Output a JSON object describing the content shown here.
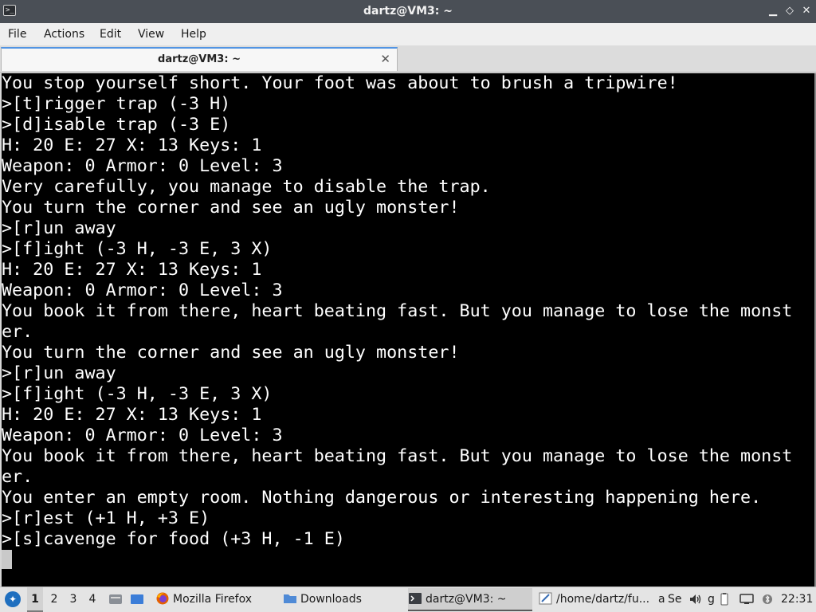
{
  "window": {
    "title": "dartz@VM3: ~",
    "minimize_glyph": "▁",
    "maximize_glyph": "◇",
    "close_glyph": "✕"
  },
  "menu": {
    "items": [
      "File",
      "Actions",
      "Edit",
      "View",
      "Help"
    ]
  },
  "tab": {
    "label": "dartz@VM3: ~",
    "close_glyph": "✕"
  },
  "terminal": {
    "lines": [
      "You stop yourself short. Your foot was about to brush a tripwire!",
      ">[t]rigger trap (-3 H)",
      ">[d]isable trap (-3 E)",
      "H: 20 E: 27 X: 13 Keys: 1",
      "Weapon: 0 Armor: 0 Level: 3",
      "Very carefully, you manage to disable the trap.",
      "You turn the corner and see an ugly monster!",
      ">[r]un away",
      ">[f]ight (-3 H, -3 E, 3 X)",
      "H: 20 E: 27 X: 13 Keys: 1",
      "Weapon: 0 Armor: 0 Level: 3",
      "You book it from there, heart beating fast. But you manage to lose the monst",
      "er.",
      "You turn the corner and see an ugly monster!",
      ">[r]un away",
      ">[f]ight (-3 H, -3 E, 3 X)",
      "H: 20 E: 27 X: 13 Keys: 1",
      "Weapon: 0 Armor: 0 Level: 3",
      "You book it from there, heart beating fast. But you manage to lose the monst",
      "er.",
      "You enter an empty room. Nothing dangerous or interesting happening here.",
      ">[r]est (+1 H, +3 E)",
      ">[s]cavenge for food (+3 H, -1 E)"
    ]
  },
  "taskbar": {
    "workspaces": [
      "1",
      "2",
      "3",
      "4"
    ],
    "active_workspace": "1",
    "tasks": {
      "firefox": "Mozilla Firefox",
      "downloads": "Downloads",
      "terminal": "dartz@VM3: ~",
      "editor": "/home/dartz/fu...",
      "editor_suffix": "a",
      "extra": "Se",
      "extra2": "g"
    },
    "clock": "22:31",
    "icons": {
      "start": "start-menu-icon",
      "files": "file-manager-icon",
      "desktop": "show-desktop-icon",
      "firefox": "firefox-icon",
      "folder": "folder-icon",
      "terminal": "terminal-icon",
      "editor": "text-editor-icon",
      "volume": "volume-icon",
      "battery": "battery-icon",
      "network": "network-icon",
      "bluetooth": "bluetooth-icon"
    }
  }
}
